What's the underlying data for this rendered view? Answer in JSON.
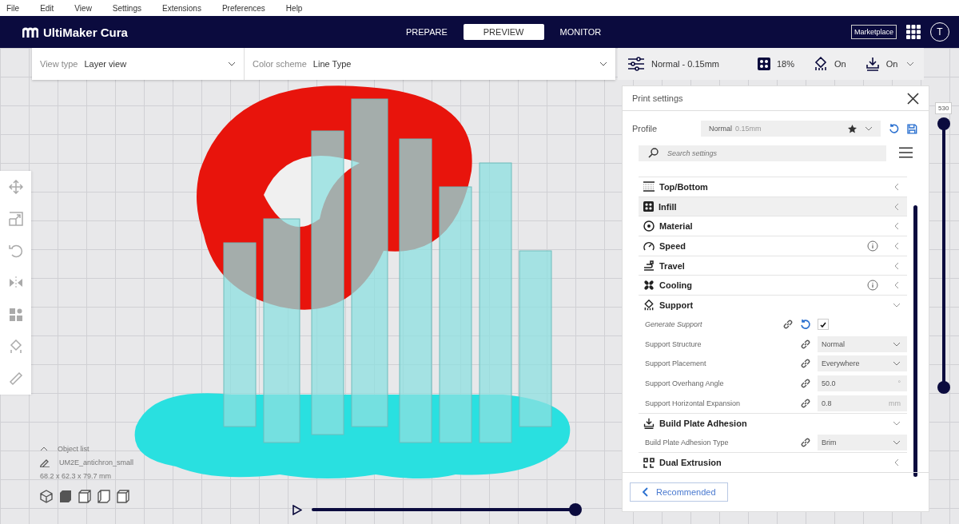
{
  "menu": [
    "File",
    "Edit",
    "View",
    "Settings",
    "Extensions",
    "Preferences",
    "Help"
  ],
  "header": {
    "logo": "UltiMaker Cura",
    "stages": [
      {
        "label": "PREPARE",
        "selected": false
      },
      {
        "label": "PREVIEW",
        "selected": true
      },
      {
        "label": "MONITOR",
        "selected": false
      }
    ],
    "marketplace": "Marketplace",
    "account_initial": "T"
  },
  "toolbar": {
    "view_type": {
      "label": "View type",
      "value": "Layer view"
    },
    "color_scheme": {
      "label": "Color scheme",
      "value": "Line Type"
    },
    "print_summary": {
      "profile": "Normal - 0.15mm",
      "infill": "18%",
      "support": "On",
      "adhesion": "On"
    }
  },
  "settings_panel": {
    "title": "Print settings",
    "profile": {
      "label": "Profile",
      "value": "Normal",
      "detail": "0.15mm"
    },
    "search": {
      "placeholder": "Search settings"
    },
    "items": [
      {
        "kind": "category",
        "label": "Top/Bottom",
        "expanded": false,
        "highlighted": false,
        "info": false
      },
      {
        "kind": "category",
        "label": "Infill",
        "expanded": false,
        "highlighted": true,
        "info": false
      },
      {
        "kind": "category",
        "label": "Material",
        "expanded": false,
        "highlighted": false,
        "info": false
      },
      {
        "kind": "category",
        "label": "Speed",
        "expanded": false,
        "highlighted": false,
        "info": true
      },
      {
        "kind": "category",
        "label": "Travel",
        "expanded": false,
        "highlighted": false,
        "info": false
      },
      {
        "kind": "category",
        "label": "Cooling",
        "expanded": false,
        "highlighted": false,
        "info": true
      },
      {
        "kind": "category",
        "label": "Support",
        "expanded": true,
        "highlighted": false,
        "info": false
      },
      {
        "kind": "checkbox_setting",
        "label": "Generate Support",
        "modified": true,
        "checked": true
      },
      {
        "kind": "dropdown_setting",
        "label": "Support Structure",
        "modified": false,
        "value": "Normal"
      },
      {
        "kind": "dropdown_setting",
        "label": "Support Placement",
        "modified": false,
        "value": "Everywhere"
      },
      {
        "kind": "number_setting",
        "label": "Support Overhang Angle",
        "modified": false,
        "value": "50.0",
        "unit": "°"
      },
      {
        "kind": "number_setting",
        "label": "Support Horizontal Expansion",
        "modified": false,
        "value": "0.8",
        "unit": "mm"
      },
      {
        "kind": "category",
        "label": "Build Plate Adhesion",
        "expanded": true,
        "highlighted": false,
        "info": false
      },
      {
        "kind": "dropdown_setting",
        "label": "Build Plate Adhesion Type",
        "modified": false,
        "value": "Brim"
      },
      {
        "kind": "category",
        "label": "Dual Extrusion",
        "expanded": false,
        "highlighted": false,
        "info": false
      }
    ],
    "footer_button": "Recommended"
  },
  "layer_slider": {
    "label": "530",
    "handles": [
      {
        "level": 1
      },
      {
        "level": 0
      }
    ]
  },
  "playback": {
    "level": 1
  },
  "object_list": {
    "title": "Object list",
    "expanded": true,
    "object_name": "UM2E_antichron_small",
    "dimensions": "68.2 x 62.3 x 79.7 mm"
  }
}
